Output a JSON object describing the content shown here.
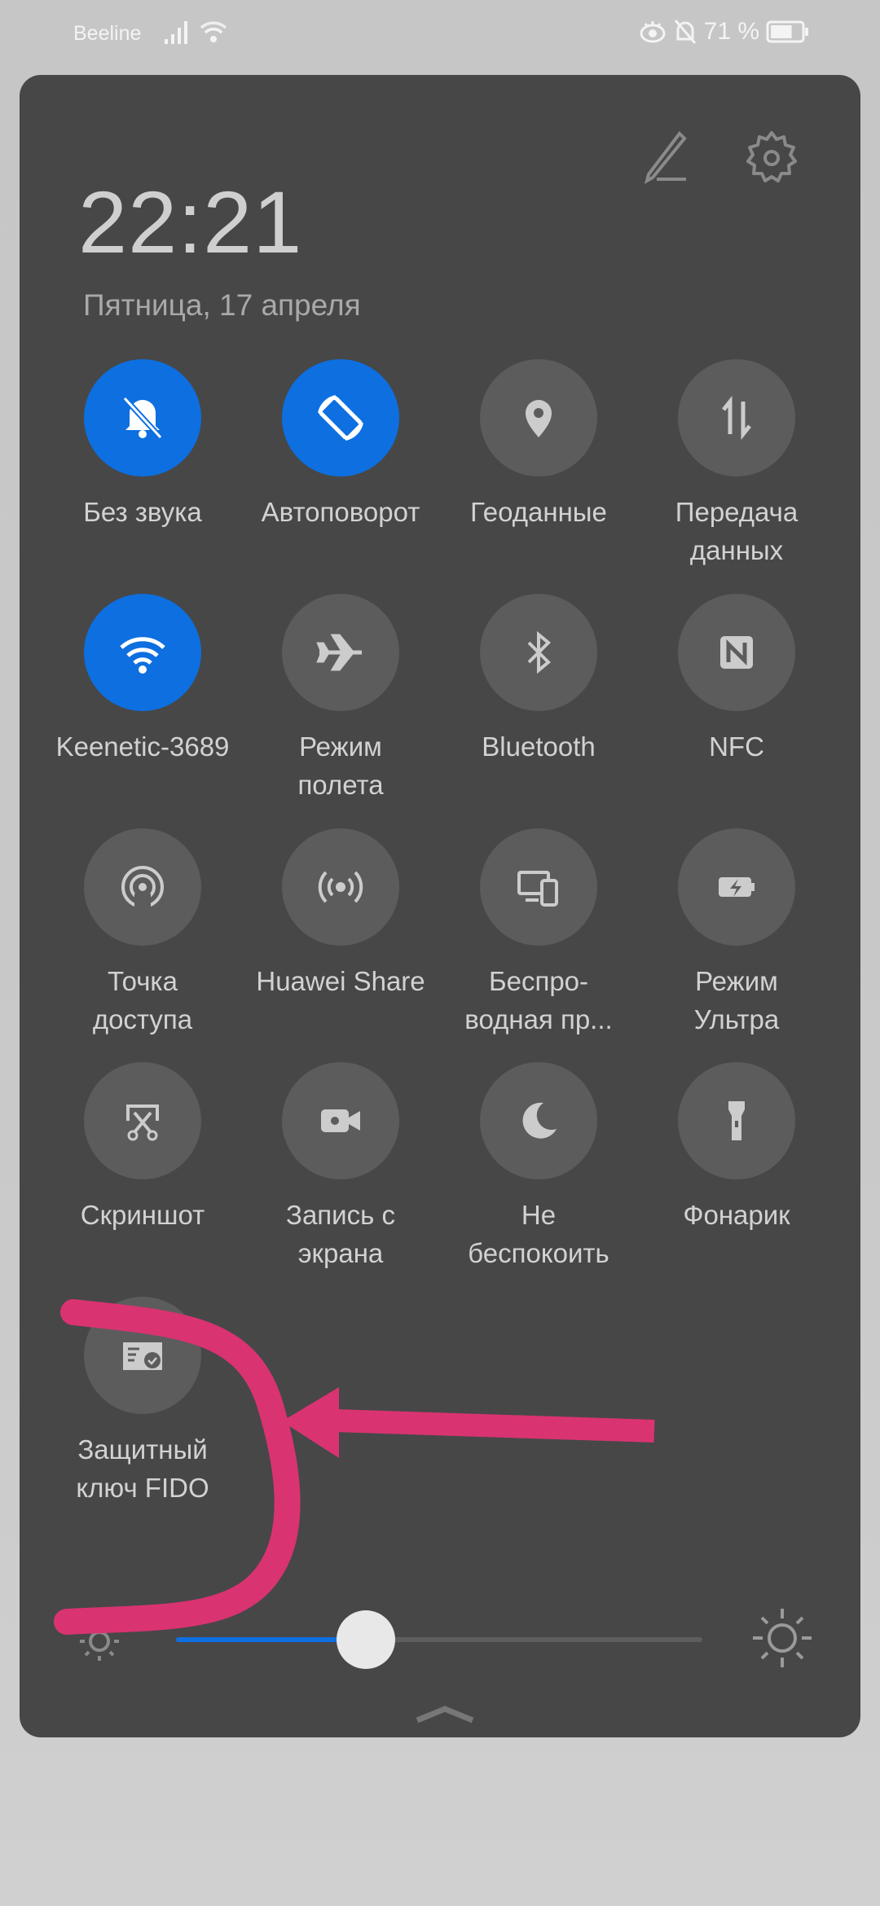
{
  "status_bar": {
    "carrier": "Beeline",
    "battery_percent": "71 %",
    "battery_level": 0.71
  },
  "header": {
    "time": "22:21",
    "date": "Пятница, 17 апреля"
  },
  "tiles": [
    {
      "label": "Без звука",
      "icon": "bell-off-icon",
      "active": true
    },
    {
      "label": "Автоповорот",
      "icon": "auto-rotate-icon",
      "active": true
    },
    {
      "label": "Геоданные",
      "icon": "location-pin-icon",
      "active": false
    },
    {
      "label": "Передача\nданных",
      "icon": "mobile-data-icon",
      "active": false
    },
    {
      "label": "Keenetic-3689",
      "icon": "wifi-icon",
      "active": true
    },
    {
      "label": "Режим\nполета",
      "icon": "airplane-icon",
      "active": false
    },
    {
      "label": "Bluetooth",
      "icon": "bluetooth-icon",
      "active": false
    },
    {
      "label": "NFC",
      "icon": "nfc-icon",
      "active": false
    },
    {
      "label": "Точка\nдоступа",
      "icon": "hotspot-icon",
      "active": false
    },
    {
      "label": "Huawei Share",
      "icon": "huawei-share-icon",
      "active": false
    },
    {
      "label": "Беспро-\nводная пр...",
      "icon": "wireless-projection-icon",
      "active": false
    },
    {
      "label": "Режим\nУльтра",
      "icon": "battery-ultra-icon",
      "active": false
    },
    {
      "label": "Скриншот",
      "icon": "screenshot-icon",
      "active": false
    },
    {
      "label": "Запись с\nэкрана",
      "icon": "screen-record-icon",
      "active": false
    },
    {
      "label": "Не\nбеспокоить",
      "icon": "moon-icon",
      "active": false
    },
    {
      "label": "Фонарик",
      "icon": "flashlight-icon",
      "active": false
    },
    {
      "label": "Защитный\nключ FIDO",
      "icon": "fido-key-icon",
      "active": false
    }
  ],
  "brightness": {
    "level": 0.36
  },
  "colors": {
    "accent": "#0d6fe0",
    "panel": "#474747",
    "annotation": "#d93372"
  }
}
